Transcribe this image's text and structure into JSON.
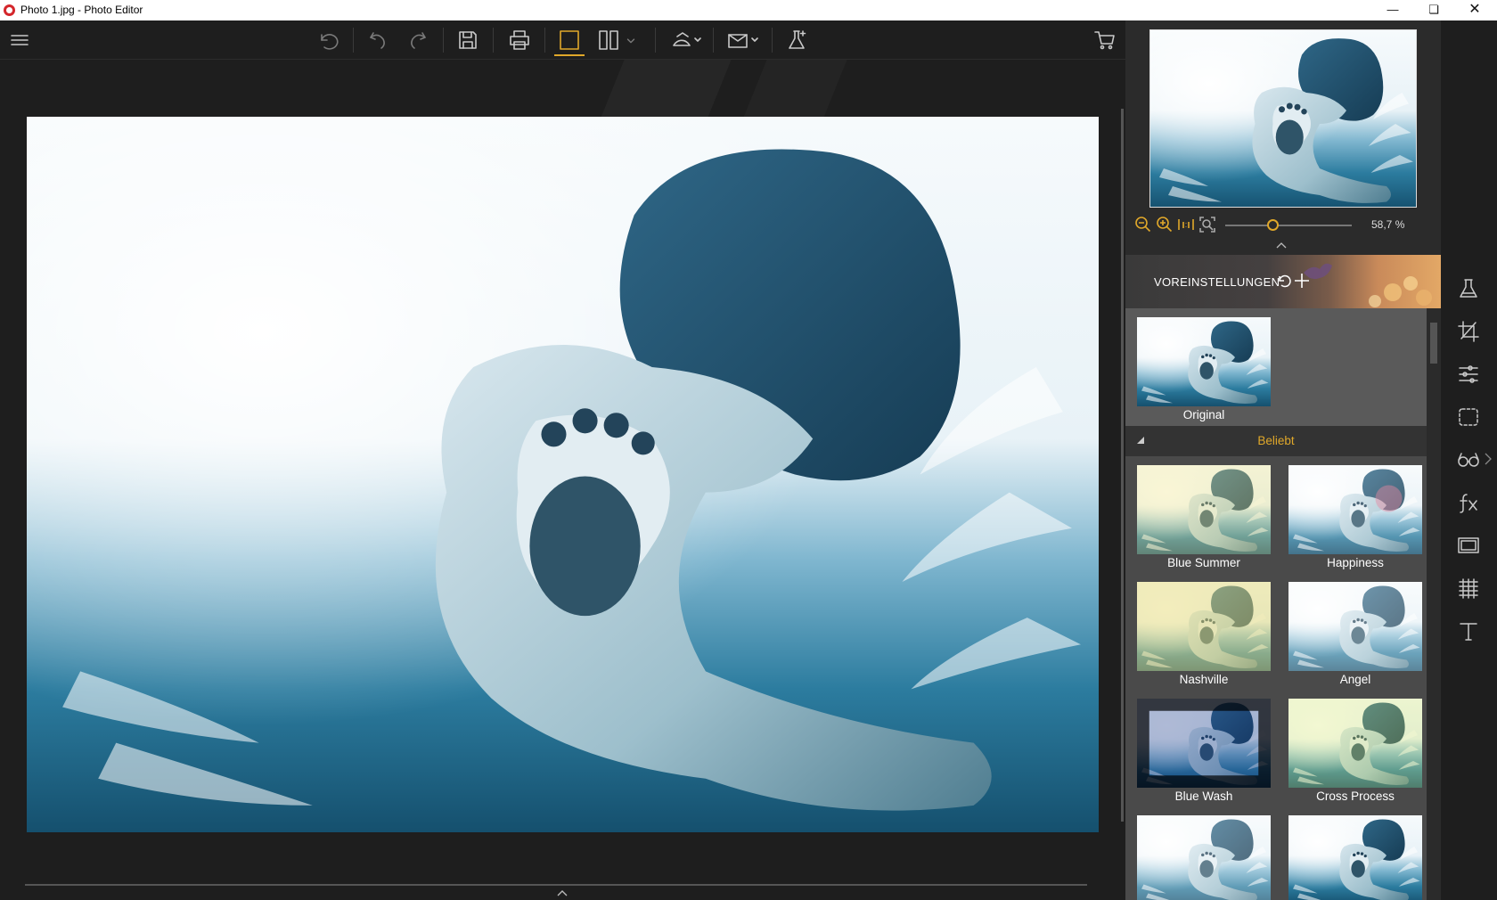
{
  "window": {
    "title": "Photo 1.jpg - Photo Editor",
    "controls": [
      "minimize",
      "restore",
      "close"
    ]
  },
  "toolbar": {
    "icons": [
      "menu-icon",
      "undo-all-icon",
      "undo-icon",
      "redo-icon",
      "save-icon",
      "print-icon",
      "single-view-icon",
      "split-view-icon",
      "dropdown-icon",
      "share-icon",
      "export-icon",
      "effects-lab-icon",
      "cart-icon"
    ]
  },
  "navigator": {
    "zoom_value": "58,7 %",
    "zoom_level": 0.587
  },
  "presets": {
    "title": "VOREINSTELLUNGEN",
    "original_label": "Original",
    "category": "Beliebt",
    "filters": [
      {
        "label": "Blue Summer"
      },
      {
        "label": "Happiness"
      },
      {
        "label": "Nashville"
      },
      {
        "label": "Angel"
      },
      {
        "label": "Blue Wash"
      },
      {
        "label": "Cross Process"
      },
      {
        "label": ""
      },
      {
        "label": ""
      }
    ]
  },
  "side_rail": {
    "icons": [
      "flask-icon",
      "crop-icon",
      "sliders-icon",
      "selection-icon",
      "glasses-icon",
      "fx-icon",
      "frame-icon",
      "texture-icon",
      "text-icon"
    ]
  },
  "colors": {
    "accent": "#e0a82a",
    "panel_bg": "#2b2b2b",
    "canvas_bg": "#1e1e1e"
  }
}
